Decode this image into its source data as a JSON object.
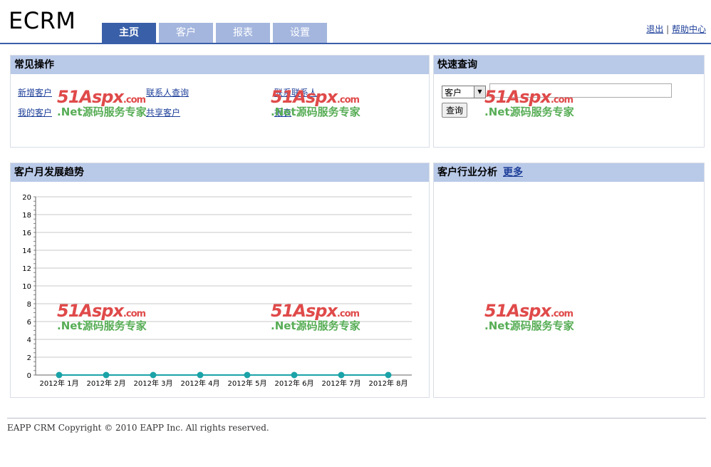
{
  "app": {
    "logo": "ECRM"
  },
  "nav": {
    "tabs": [
      {
        "label": "主页",
        "active": true
      },
      {
        "label": "客户",
        "active": false
      },
      {
        "label": "报表",
        "active": false
      },
      {
        "label": "设置",
        "active": false
      }
    ],
    "logout": "退出",
    "separator": "|",
    "help": "帮助中心"
  },
  "common_ops": {
    "title": "常见操作",
    "links": [
      "新增客户",
      "联系人查询",
      "联系联系人",
      "我的客户",
      "共享客户",
      "报表"
    ]
  },
  "quick_search": {
    "title": "快速查询",
    "select_value": "客户",
    "input_value": "",
    "button": "查询"
  },
  "trend": {
    "title": "客户月发展趋势"
  },
  "industry": {
    "title": "客户行业分析",
    "more": "更多"
  },
  "watermark": {
    "brand": "51Aspx",
    "domain": ".com",
    "slogan": ".Net源码服务专家"
  },
  "colors": {
    "tab_active": "#3a5fa9",
    "tab": "#a4b6de",
    "panel_head": "#b9c9e8",
    "series": "#1aa3a8"
  },
  "footer": {
    "copyright": "EAPP CRM Copyright © 2010 EAPP Inc. All rights reserved."
  },
  "chart_data": {
    "type": "line",
    "categories": [
      "2012年 1月",
      "2012年 2月",
      "2012年 3月",
      "2012年 4月",
      "2012年 5月",
      "2012年 6月",
      "2012年 7月",
      "2012年 8月"
    ],
    "values": [
      0,
      0,
      0,
      0,
      0,
      0,
      0,
      0
    ],
    "y_ticks": [
      "0",
      "2",
      "4",
      "6",
      "8",
      "10",
      "12",
      "14",
      "16",
      "18",
      "20"
    ],
    "ylim": [
      0,
      20
    ],
    "grid": true
  }
}
